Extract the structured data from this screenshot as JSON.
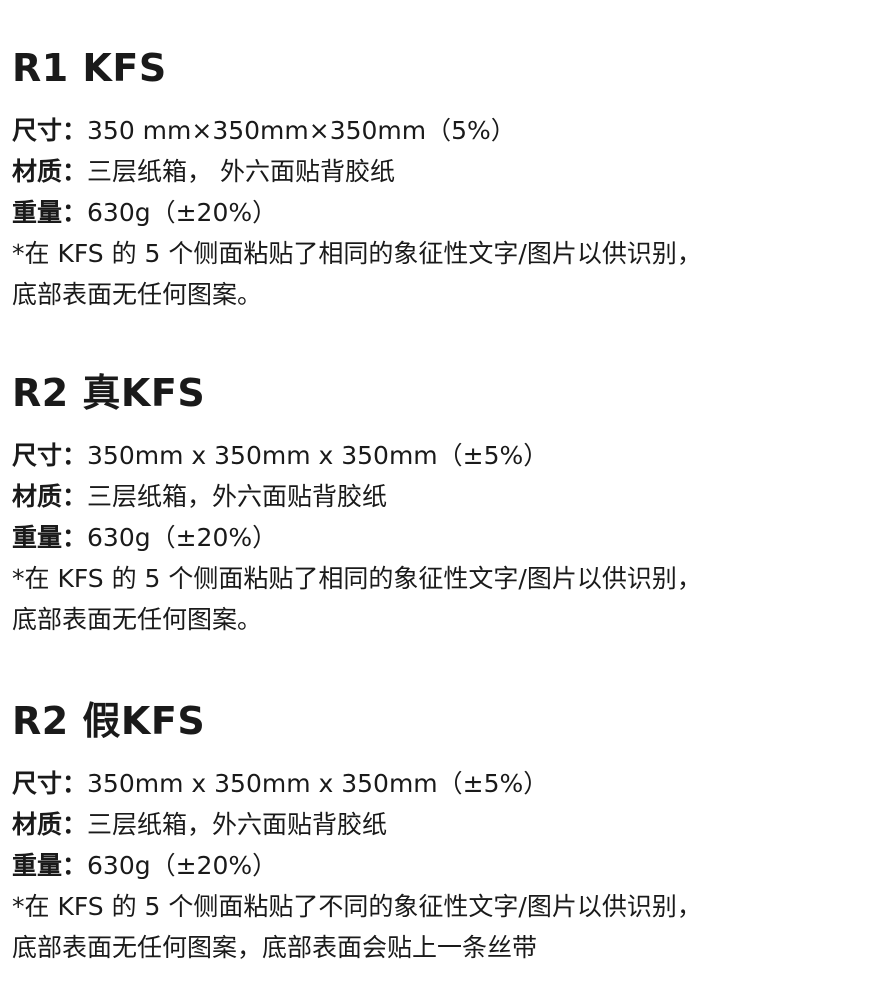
{
  "sections": [
    {
      "title": "R1 KFS",
      "size_label": "尺寸：",
      "size_value": "350 mm×350mm×350mm（5%）",
      "material_label": "材质：",
      "material_value": "三层纸箱， 外六面贴背胶纸",
      "weight_label": "重量：",
      "weight_value": "630g（±20%）",
      "note_line1": "*在 KFS 的 5 个侧面粘贴了相同的象征性文字/图片以供识别，",
      "note_line2": "底部表面无任何图案。"
    },
    {
      "title": "R2 真KFS",
      "size_label": "尺寸：",
      "size_value": "350mm x 350mm x 350mm（±5%）",
      "material_label": "材质：",
      "material_value": "三层纸箱，外六面贴背胶纸",
      "weight_label": "重量：",
      "weight_value": "630g（±20%）",
      "note_line1": "*在 KFS 的 5 个侧面粘贴了相同的象征性文字/图片以供识别，",
      "note_line2": "底部表面无任何图案。"
    },
    {
      "title": "R2 假KFS",
      "size_label": "尺寸：",
      "size_value": "350mm x 350mm x 350mm（±5%）",
      "material_label": "材质：",
      "material_value": "三层纸箱，外六面贴背胶纸",
      "weight_label": "重量：",
      "weight_value": "630g（±20%）",
      "note_line1": "*在 KFS 的 5 个侧面粘贴了不同的象征性文字/图片以供识别，",
      "note_line2": "底部表面无任何图案，底部表面会贴上一条丝带"
    }
  ]
}
